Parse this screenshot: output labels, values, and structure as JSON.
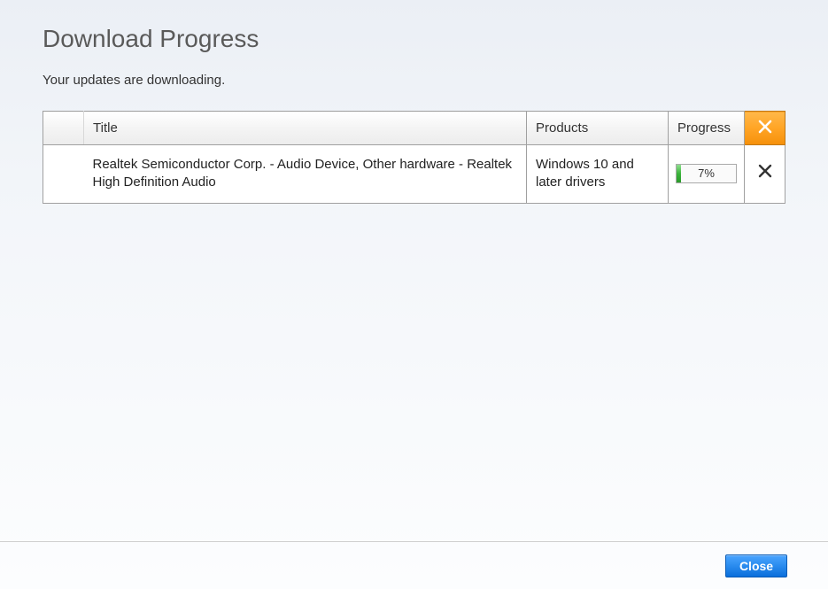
{
  "header": {
    "title": "Download Progress",
    "status": "Your updates are downloading."
  },
  "table": {
    "columns": {
      "title": "Title",
      "products": "Products",
      "progress": "Progress"
    },
    "rows": [
      {
        "title": "Realtek Semiconductor Corp. - Audio Device, Other hardware - Realtek High Definition Audio",
        "products": "Windows 10 and later drivers",
        "progress_percent": 7,
        "progress_label": "7%"
      }
    ]
  },
  "footer": {
    "close_label": "Close"
  },
  "colors": {
    "cancel_all_bg": "#f5900a",
    "progress_fill": "#3bb33b",
    "close_btn": "#0a6edb"
  }
}
